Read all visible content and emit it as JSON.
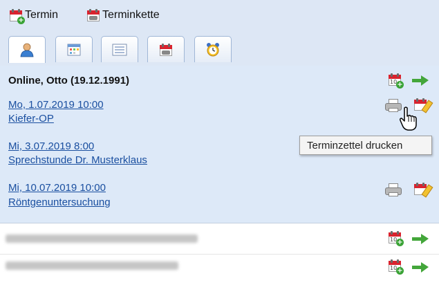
{
  "toolbar": {
    "termin_label": "Termin",
    "terminkette_label": "Terminkette"
  },
  "tabs": [
    {
      "name": "person-tab",
      "icon": "person-icon"
    },
    {
      "name": "calendar-grid-tab",
      "icon": "calendar-grid-icon"
    },
    {
      "name": "list-tab",
      "icon": "list-icon"
    },
    {
      "name": "phone-calendar-tab",
      "icon": "phone-calendar-icon"
    },
    {
      "name": "alarm-tab",
      "icon": "alarm-clock-icon"
    }
  ],
  "patient": {
    "name": "Online, Otto (19.12.1991)"
  },
  "appointments": [
    {
      "date": "Mo, 1.07.2019 10:00",
      "title": "Kiefer-OP"
    },
    {
      "date": "Mi, 3.07.2019 8:00",
      "title": "Sprechstunde Dr. Musterklaus"
    },
    {
      "date": "Mi, 10.07.2019 10:00",
      "title": "Röntgenuntersuchung"
    }
  ],
  "tooltip": {
    "text": "Terminzettel drucken"
  },
  "colors": {
    "link": "#1a4fa0",
    "section_bg": "#dde9f8",
    "toolbar_bg": "#dde7f5",
    "arrow": "#43a63a",
    "calendar_red": "#d9232e"
  }
}
